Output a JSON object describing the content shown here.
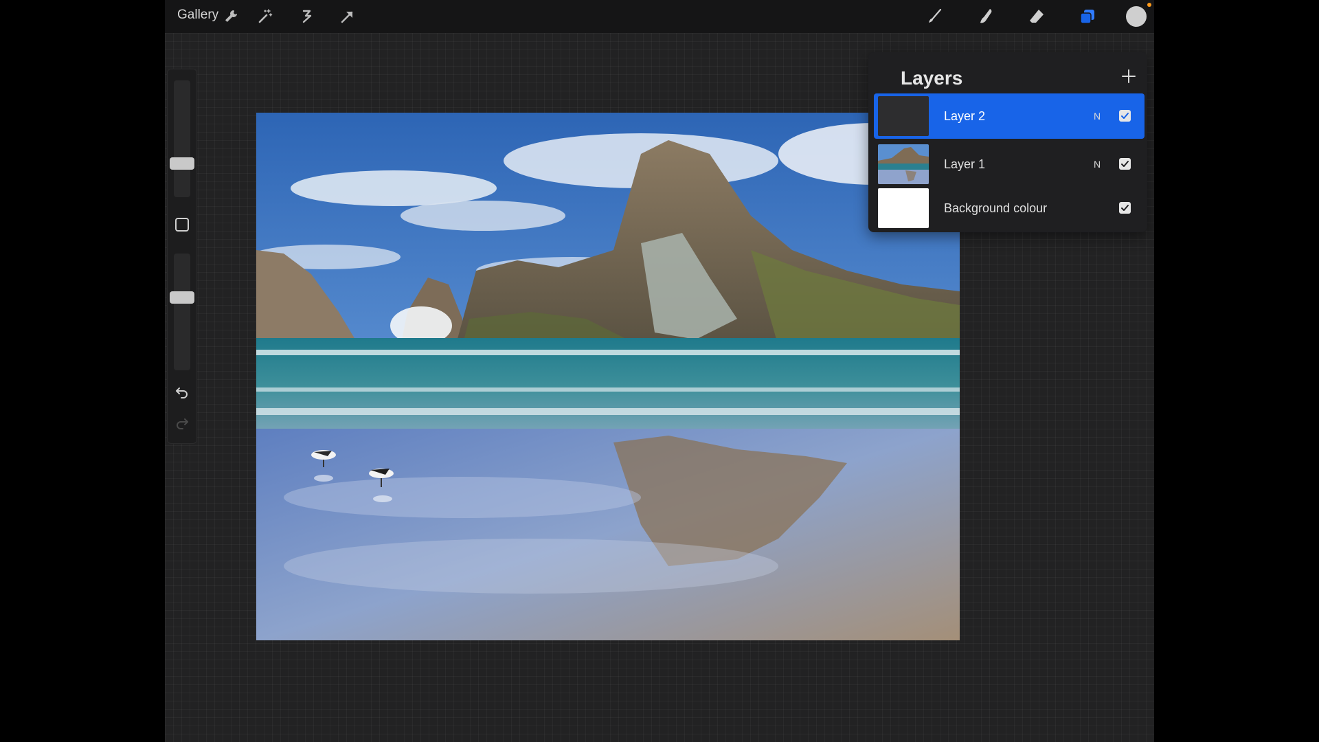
{
  "topbar": {
    "gallery_label": "Gallery",
    "left_icons": [
      "wrench-icon",
      "magic-wand-icon",
      "selection-icon",
      "transform-arrow-icon"
    ],
    "right_icons": [
      "brush-icon",
      "smudge-icon",
      "eraser-icon",
      "layers-icon",
      "color-picker-dot"
    ],
    "active_tool": "layers",
    "accent_color": "#1864e8",
    "current_color": "#cfcfcf",
    "notification_color": "#ff9a1a"
  },
  "sidebar": {
    "brush_size_level": 0.7,
    "opacity_level": 0.65,
    "icons": [
      "modify-square-icon",
      "undo-icon",
      "redo-icon"
    ]
  },
  "layers_panel": {
    "title": "Layers",
    "add_icon": "plus-icon",
    "layers": [
      {
        "name": "Layer 2",
        "blend": "N",
        "visible": true,
        "selected": true
      },
      {
        "name": "Layer 1",
        "blend": "N",
        "visible": true,
        "selected": false
      },
      {
        "name": "Background colour",
        "blend": "",
        "visible": true,
        "selected": false
      }
    ]
  },
  "canvas": {
    "image": "beach landscape with rocky headland and seagulls"
  }
}
